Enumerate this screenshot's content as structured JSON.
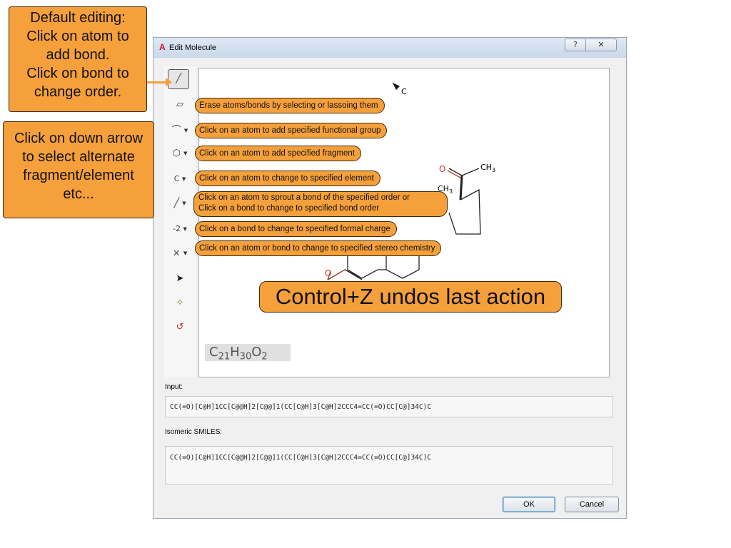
{
  "window": {
    "title": "Edit Molecule",
    "logo": "A",
    "help_glyph": "?",
    "close_glyph": "✕"
  },
  "toolbar": {
    "tools": [
      {
        "name": "pencil-icon",
        "glyph": "╱"
      },
      {
        "name": "eraser-icon",
        "glyph": "▱"
      },
      {
        "name": "functional-group-icon",
        "glyph": "⌒"
      },
      {
        "name": "fragment-icon",
        "glyph": "⬡"
      },
      {
        "name": "element",
        "glyph": "C"
      },
      {
        "name": "bond-icon",
        "glyph": "╱"
      },
      {
        "name": "charge",
        "glyph": "-2"
      },
      {
        "name": "stereo-icon",
        "glyph": "⨯"
      },
      {
        "name": "select-arrow-icon",
        "glyph": "➤"
      },
      {
        "name": "clean-icon",
        "glyph": "✧"
      },
      {
        "name": "undo-icon",
        "glyph": "↺"
      }
    ],
    "dropdown_glyph": "▼"
  },
  "canvas": {
    "formula": {
      "c": "C",
      "c_n": "21",
      "h": "H",
      "h_n": "30",
      "o": "O",
      "o_n": "2"
    },
    "atom_labels": {
      "c_top": "C",
      "o_ketone": "O",
      "ch3_methyl": "CH",
      "ch3_sub": "3",
      "ch3_ring": "CH",
      "ch3_ring_sub": "3",
      "o_enone": "O"
    }
  },
  "input": {
    "label": "Input:",
    "value": "CC(=O)[C@H]1CC[C@@H]2[C@@]1(CC[C@H]3[C@H]2CCC4=CC(=O)CC[C@]34C)C"
  },
  "smiles": {
    "label": "Isomeric SMILES:",
    "value": "CC(=O)[C@H]1CC[C@@H]2[C@@]1(CC[C@H]3[C@H]2CCC4=CC(=O)CC[C@]34C)C"
  },
  "buttons": {
    "ok": "OK",
    "cancel": "Cancel"
  },
  "annotations": {
    "default_editing": [
      "Default editing:",
      "Click on atom to",
      "add bond.",
      "Click on bond to",
      "change order."
    ],
    "down_arrow": [
      "Click on down arrow",
      "to select alternate",
      "fragment/element",
      "etc..."
    ],
    "eraser": "Erase atoms/bonds by selecting or lassoing them",
    "functional_group": "Click on an atom to add specified functional group",
    "fragment": "Click on an atom to add specified fragment",
    "element": "Click on an atom to change to specified element",
    "bond_line1": "Click on an atom to sprout a bond of the specified order or",
    "bond_line2": "Click on a bond to change to specified bond order",
    "charge": "Click on a bond to change to specified formal charge",
    "stereo": "Click on an atom or bond to change to specified stereo chemistry",
    "undo": "Control+Z undos last action"
  }
}
